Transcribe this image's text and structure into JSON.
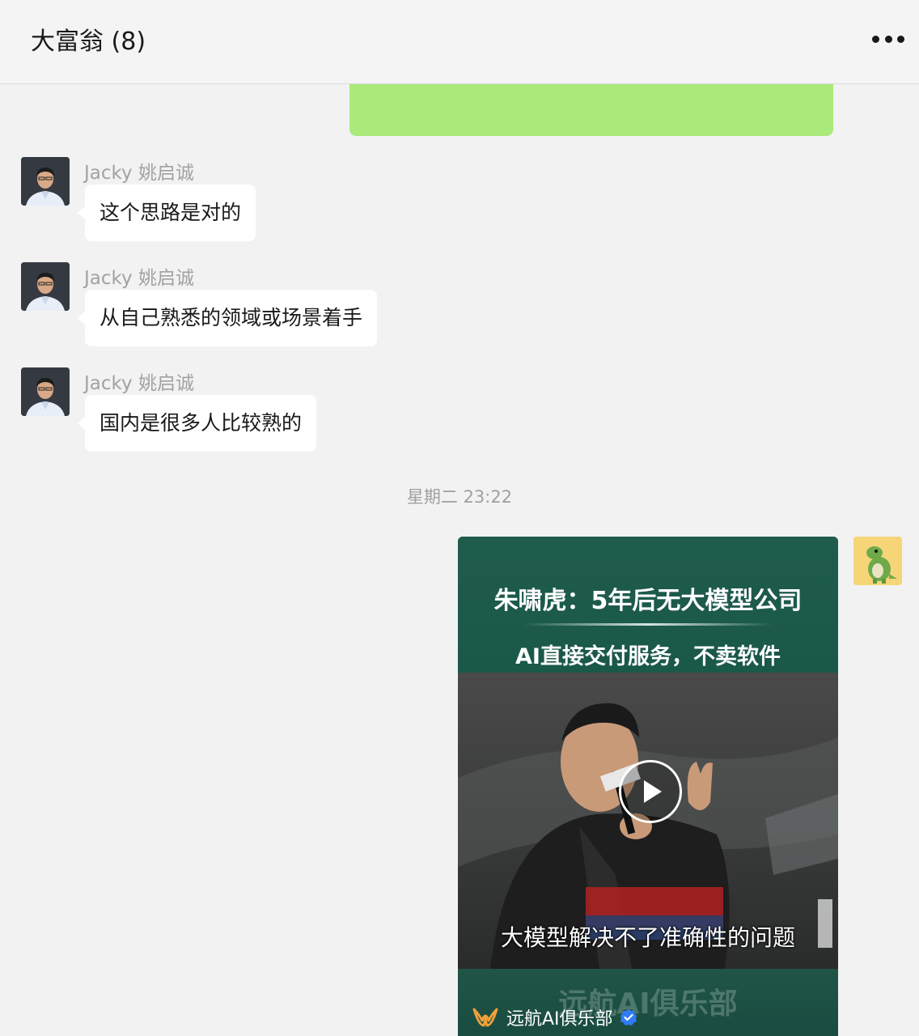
{
  "header": {
    "title": "大富翁 (8)",
    "more_icon": "more-dots-icon"
  },
  "messages": [
    {
      "sender": "Jacky 姚启诚",
      "text": "这个思路是对的"
    },
    {
      "sender": "Jacky 姚启诚",
      "text": "从自己熟悉的领域或场景着手"
    },
    {
      "sender": "Jacky 姚启诚",
      "text": "国内是很多人比较熟的"
    }
  ],
  "timestamp": "星期二 23:22",
  "video": {
    "title": "朱啸虎：5年后无大模型公司",
    "subtitle": "AI直接交付服务，不卖软件",
    "caption": "大模型解决不了准确性的问题",
    "watermark": "远航AI俱乐部",
    "channel": "远航AI俱乐部",
    "play_icon": "play-icon",
    "verified_icon": "verified-badge-icon"
  },
  "colors": {
    "sent_bubble": "#a9ea7a",
    "received_bubble": "#ffffff",
    "background": "#f2f2f2",
    "video_green": "#1f5c4c"
  }
}
